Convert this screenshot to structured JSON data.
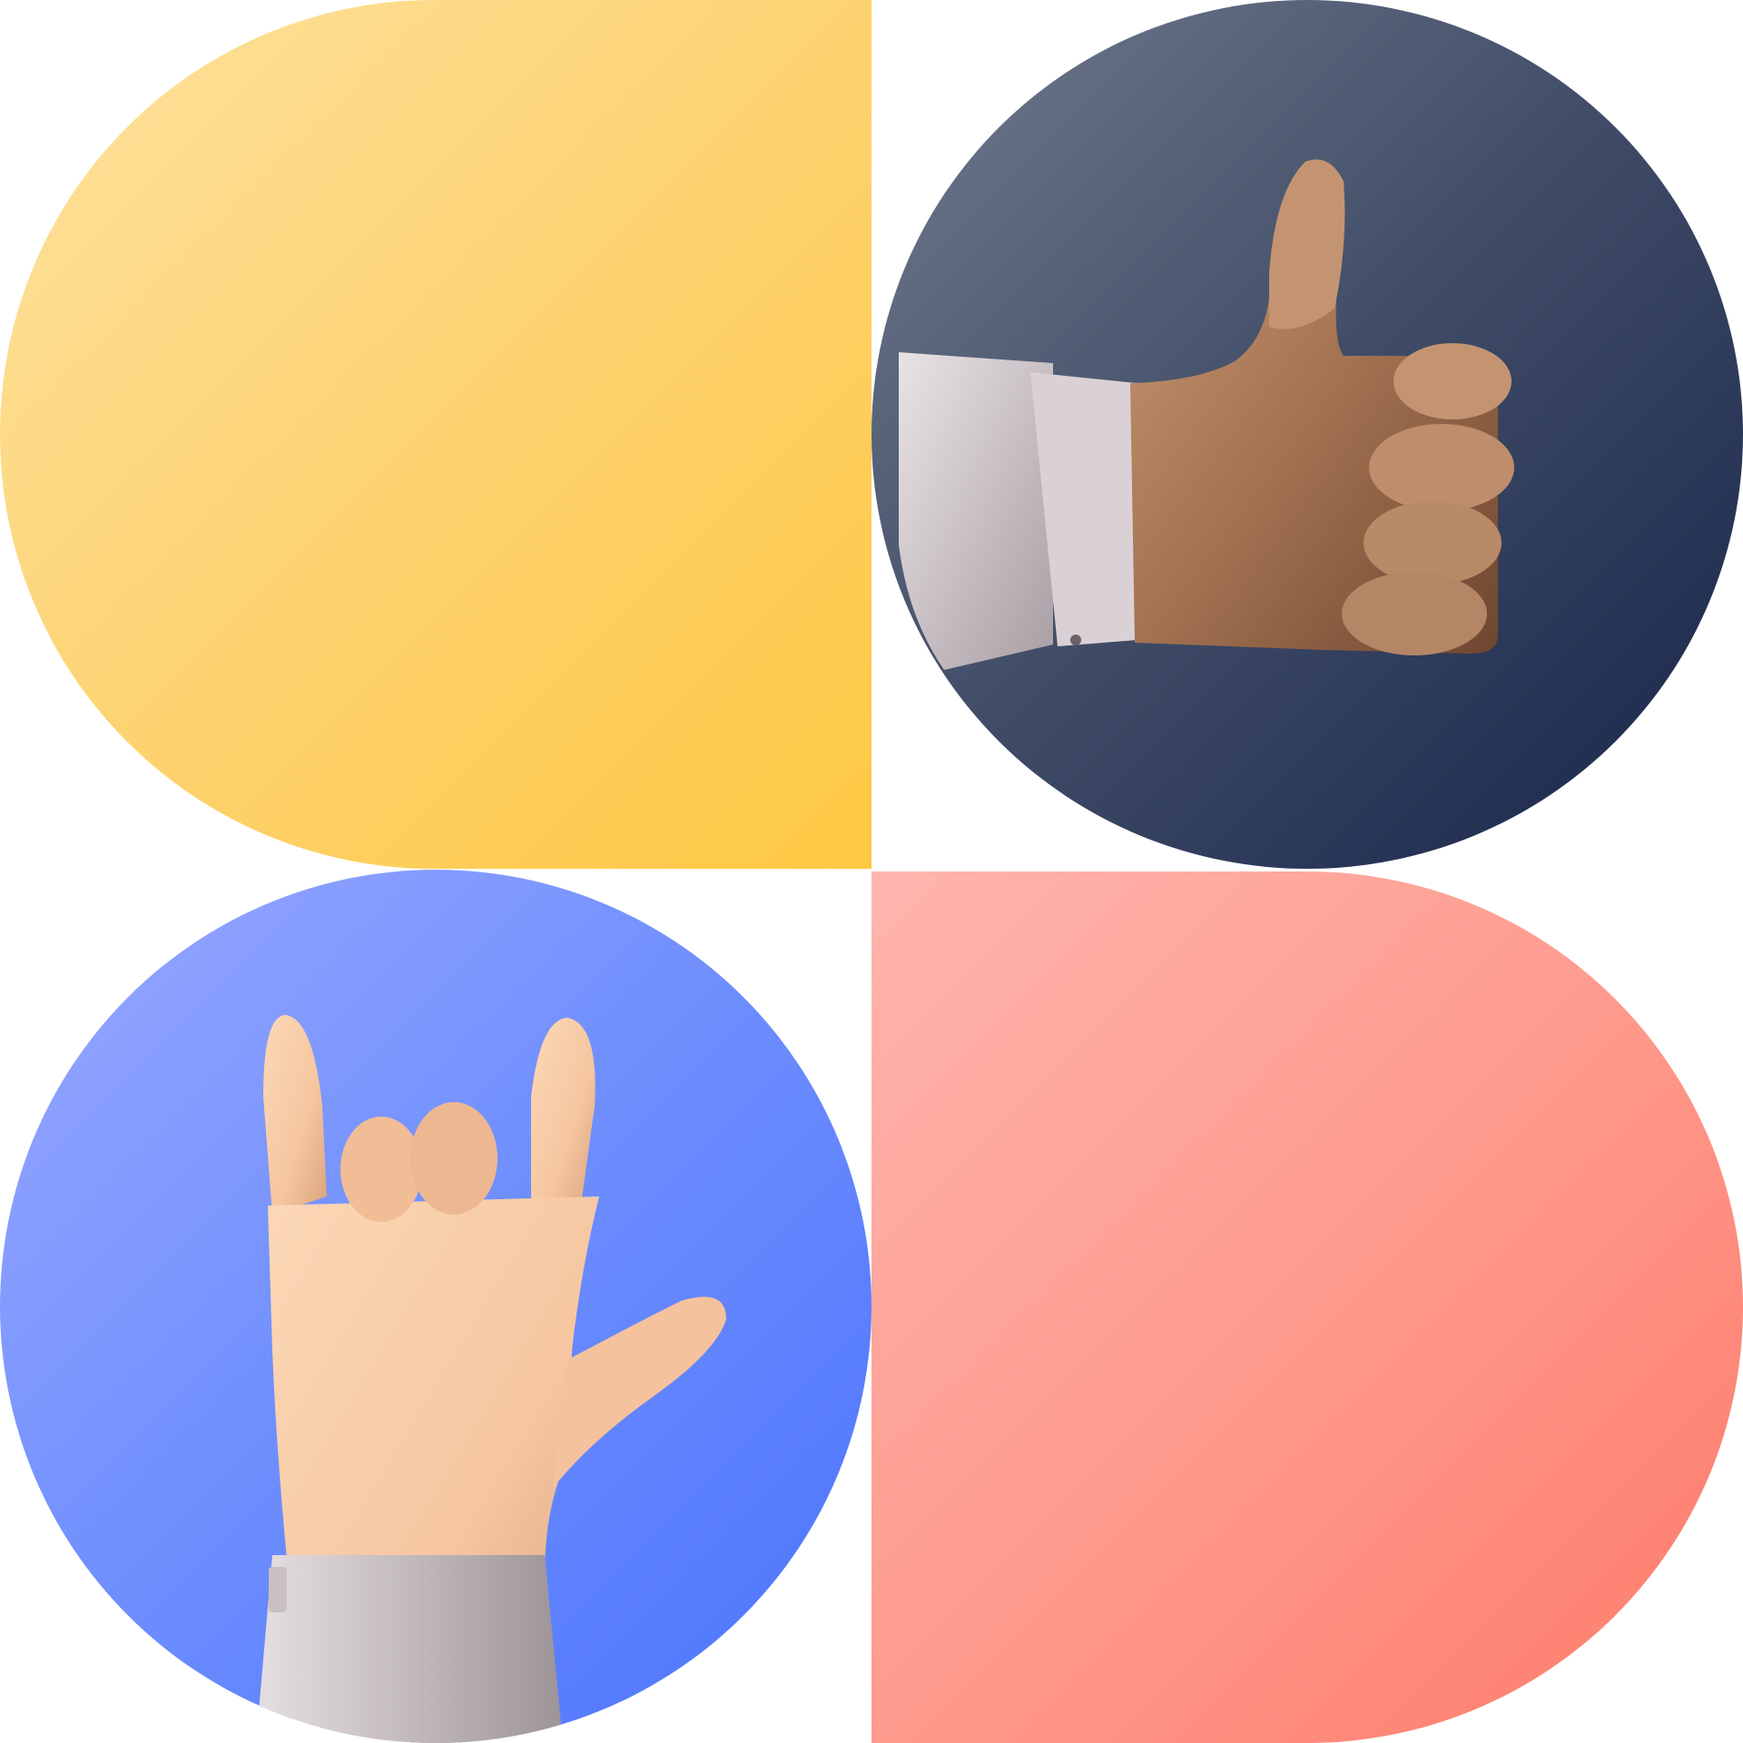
{
  "tiles": [
    {
      "id": "yellow",
      "shape": "half-rounded-left",
      "colors": [
        "#fde3a0",
        "#fdd476",
        "#fec842"
      ]
    },
    {
      "id": "navy",
      "shape": "circle",
      "colors": [
        "#727c8e",
        "#3f4b66",
        "#16244a"
      ],
      "icon": "thumbs-up-hand-icon"
    },
    {
      "id": "blue",
      "shape": "circle",
      "colors": [
        "#9aa9ff",
        "#7190fe",
        "#4a73fd"
      ],
      "icon": "rock-on-hand-icon"
    },
    {
      "id": "coral",
      "shape": "half-rounded-right",
      "colors": [
        "#feb5ae",
        "#fe9a8d",
        "#fe7a69"
      ]
    }
  ]
}
